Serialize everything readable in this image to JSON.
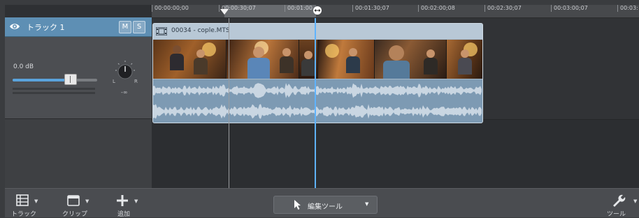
{
  "ruler": {
    "ticks": [
      "00:00:00;00",
      "00:00:30;07",
      "00:01:00",
      "00:01:30;07",
      "00:02:00;08",
      "00:02:30;07",
      "00:03:00;07",
      "00:03:"
    ]
  },
  "track": {
    "name": "トラック 1",
    "mute_label": "M",
    "solo_label": "S",
    "volume_text": "0.0 dB",
    "volume_level": 0.7,
    "pan_left": "L",
    "pan_right": "R",
    "pan_value": "-∞"
  },
  "clip": {
    "title": "00034 - cople.MTS"
  },
  "toolbar": {
    "track_label": "トラック",
    "clip_label": "クリップ",
    "add_label": "追加",
    "edit_tool_label": "編集ツール",
    "tools_label": "ツール"
  },
  "colors": {
    "accent": "#5fb3ff",
    "track_header": "#5e8fb4",
    "clip": "#a5b8c8"
  }
}
